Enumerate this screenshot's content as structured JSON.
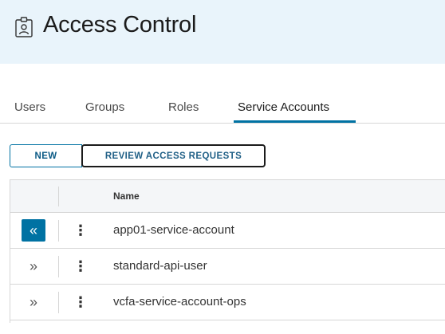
{
  "header": {
    "title": "Access Control",
    "icon": "badge-id-icon",
    "background": "#e9f4fb"
  },
  "tabs": [
    {
      "label": "Users",
      "active": false
    },
    {
      "label": "Groups",
      "active": false
    },
    {
      "label": "Roles",
      "active": false
    },
    {
      "label": "Service Accounts",
      "active": true
    }
  ],
  "toolbar": {
    "new_label": "NEW",
    "review_label": "REVIEW ACCESS REQUESTS"
  },
  "grid": {
    "columns": [
      "Name"
    ],
    "rows": [
      {
        "name": "app01-service-account",
        "expander": "«",
        "expanded": true
      },
      {
        "name": "standard-api-user",
        "expander": "»",
        "expanded": false
      },
      {
        "name": "vcfa-service-account-ops",
        "expander": "»",
        "expanded": false
      }
    ],
    "row_menu_glyph": "⋮"
  },
  "colors": {
    "accent": "#0072a3",
    "border": "#d6d6d6",
    "text": "#333333"
  }
}
